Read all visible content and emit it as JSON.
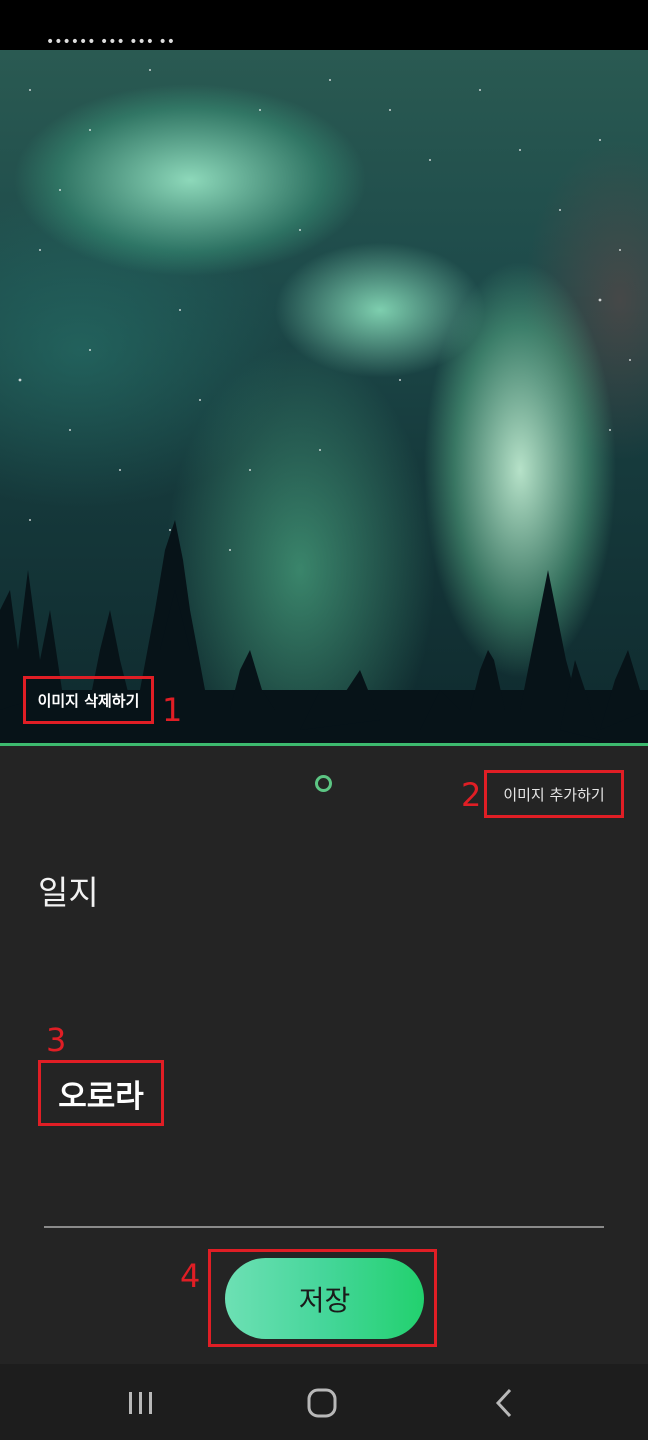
{
  "status_bar": {
    "text": "•••••• ••• ••• ••"
  },
  "hero": {
    "image_desc": "aurora-borealis-photo"
  },
  "image_actions": {
    "delete_label": "이미지 삭제하기",
    "add_label": "이미지 추가하기"
  },
  "journal": {
    "title": "일지",
    "text": "오로라"
  },
  "save": {
    "label": "저장"
  },
  "annotations": {
    "n1": "1",
    "n2": "2",
    "n3": "3",
    "n4": "4"
  },
  "nav": {
    "recent_icon": "recent-apps-icon",
    "home_icon": "home-icon",
    "back_icon": "back-icon"
  },
  "colors": {
    "accent_green": "#3dbb6f",
    "annotation_red": "#e01e25",
    "background": "#242424"
  }
}
